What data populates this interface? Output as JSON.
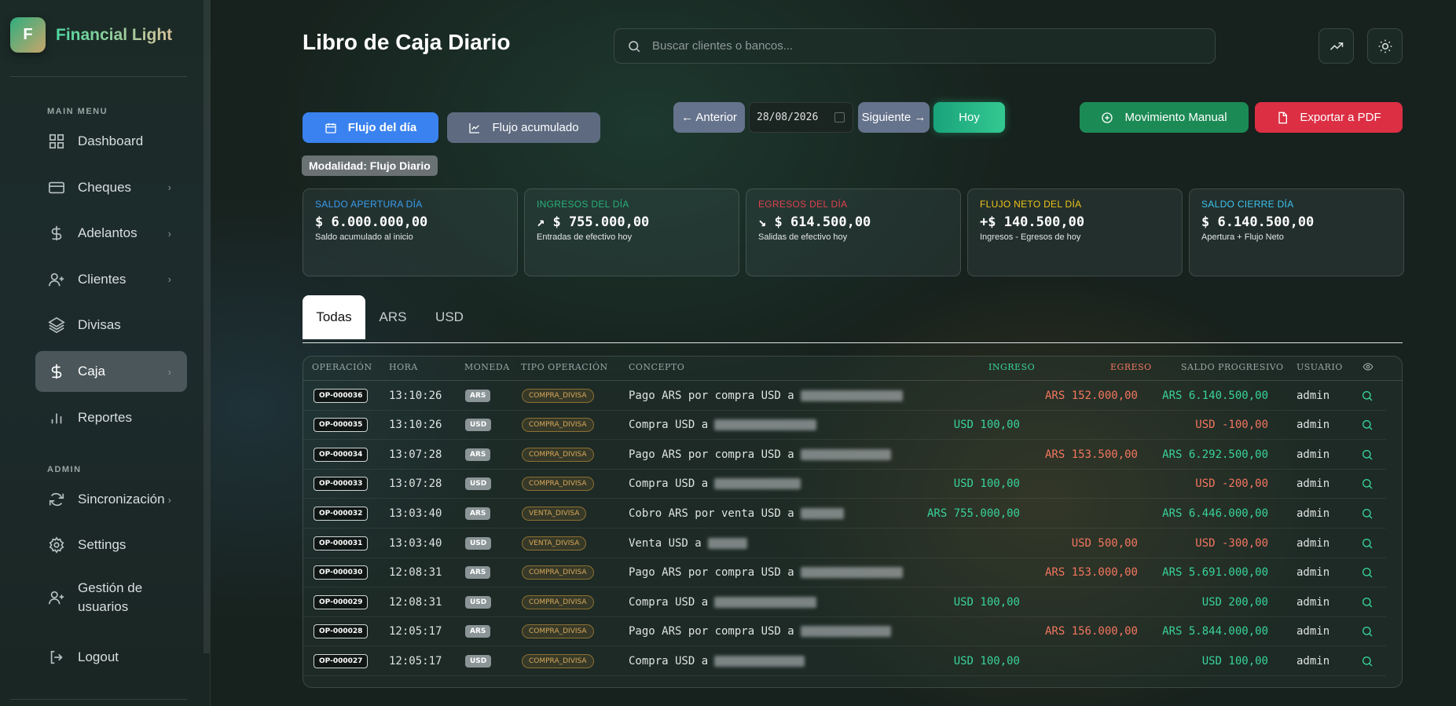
{
  "brand": {
    "initial": "F",
    "name": "Financial Light"
  },
  "sidebar": {
    "main_menu_label": "MAIN MENU",
    "admin_label": "ADMIN",
    "items": [
      {
        "label": "Dashboard",
        "icon": "grid-icon",
        "chevron": ""
      },
      {
        "label": "Cheques",
        "icon": "card-icon",
        "chevron": "›"
      },
      {
        "label": "Adelantos",
        "icon": "dollar-icon",
        "chevron": "›"
      },
      {
        "label": "Clientes",
        "icon": "user-plus-icon",
        "chevron": "›"
      },
      {
        "label": "Divisas",
        "icon": "layers-icon",
        "chevron": ""
      },
      {
        "label": "Caja",
        "icon": "dollar-icon",
        "chevron": "›",
        "active": true
      },
      {
        "label": "Reportes",
        "icon": "bar-chart-icon",
        "chevron": ""
      }
    ],
    "admin_items": [
      {
        "label": "Sincronización",
        "icon": "refresh-icon",
        "chevron": "›"
      },
      {
        "label": "Settings",
        "icon": "gear-icon",
        "chevron": ""
      },
      {
        "label": "Gestión de usuarios",
        "icon": "user-plus-icon",
        "chevron": ""
      },
      {
        "label": "Logout",
        "icon": "logout-icon",
        "chevron": ""
      }
    ]
  },
  "header": {
    "title": "Libro de Caja Diario",
    "search_placeholder": "Buscar clientes o bancos..."
  },
  "toolbar": {
    "flujo_dia": "Flujo del día",
    "flujo_acumulado": "Flujo acumulado",
    "anterior": "← Anterior",
    "date": "28/08/2026",
    "siguiente": "Siguiente →",
    "hoy": "Hoy",
    "movimiento_manual": "Movimiento Manual",
    "exportar_pdf": "Exportar a PDF",
    "modalidad": "Modalidad: Flujo Diario"
  },
  "cards": [
    {
      "title": "SALDO APERTURA DÍA",
      "value": "$ 6.000.000,00",
      "sub": "Saldo acumulado al inicio",
      "color": "#3a9cf0"
    },
    {
      "title": "INGRESOS DEL DÍA",
      "value": "↗ $ 755.000,00",
      "sub": "Entradas de efectivo hoy",
      "color": "#27b07a"
    },
    {
      "title": "EGRESOS DEL DÍA",
      "value": "↘ $ 614.500,00",
      "sub": "Salidas de efectivo hoy",
      "color": "#e0404f"
    },
    {
      "title": "FLUJO NETO DEL DÍA",
      "value": "+$ 140.500,00",
      "sub": "Ingresos - Egresos de hoy",
      "color": "#f0c419"
    },
    {
      "title": "SALDO CIERRE DÍA",
      "value": "$ 6.140.500,00",
      "sub": "Apertura + Flujo Neto",
      "color": "#3ec3f0"
    }
  ],
  "tabs": [
    "Todas",
    "ARS",
    "USD"
  ],
  "table": {
    "headers": {
      "operacion": "OPERACIÓN",
      "hora": "HORA",
      "moneda": "MONEDA",
      "tipo": "TIPO OPERACIÓN",
      "concepto": "CONCEPTO",
      "ingreso": "INGRESO",
      "egreso": "EGRESO",
      "saldo": "SALDO PROGRESIVO",
      "usuario": "USUARIO"
    },
    "rows": [
      {
        "op": "OP-000036",
        "hora": "13:10:26",
        "moneda": "ARS",
        "tipo": "COMPRA_DIVISA",
        "concepto": "Pago ARS por compra USD a",
        "blur_w": 130,
        "ingreso": "",
        "egreso": "ARS 152.000,00",
        "saldo": "ARS 6.140.500,00",
        "saldo_pos": true,
        "usuario": "admin"
      },
      {
        "op": "OP-000035",
        "hora": "13:10:26",
        "moneda": "USD",
        "tipo": "COMPRA_DIVISA",
        "concepto": "Compra USD a",
        "blur_w": 130,
        "ingreso": "USD 100,00",
        "egreso": "",
        "saldo": "USD -100,00",
        "saldo_pos": false,
        "usuario": "admin"
      },
      {
        "op": "OP-000034",
        "hora": "13:07:28",
        "moneda": "ARS",
        "tipo": "COMPRA_DIVISA",
        "concepto": "Pago ARS por compra USD a",
        "blur_w": 115,
        "ingreso": "",
        "egreso": "ARS 153.500,00",
        "saldo": "ARS 6.292.500,00",
        "saldo_pos": true,
        "usuario": "admin"
      },
      {
        "op": "OP-000033",
        "hora": "13:07:28",
        "moneda": "USD",
        "tipo": "COMPRA_DIVISA",
        "concepto": "Compra USD a",
        "blur_w": 110,
        "ingreso": "USD 100,00",
        "egreso": "",
        "saldo": "USD -200,00",
        "saldo_pos": false,
        "usuario": "admin"
      },
      {
        "op": "OP-000032",
        "hora": "13:03:40",
        "moneda": "ARS",
        "tipo": "VENTA_DIVISA",
        "concepto": "Cobro ARS por venta USD a",
        "blur_w": 55,
        "ingreso": "ARS 755.000,00",
        "egreso": "",
        "saldo": "ARS 6.446.000,00",
        "saldo_pos": true,
        "usuario": "admin"
      },
      {
        "op": "OP-000031",
        "hora": "13:03:40",
        "moneda": "USD",
        "tipo": "VENTA_DIVISA",
        "concepto": "Venta USD a",
        "blur_w": 50,
        "ingreso": "",
        "egreso": "USD 500,00",
        "saldo": "USD -300,00",
        "saldo_pos": false,
        "usuario": "admin"
      },
      {
        "op": "OP-000030",
        "hora": "12:08:31",
        "moneda": "ARS",
        "tipo": "COMPRA_DIVISA",
        "concepto": "Pago ARS por compra USD a",
        "blur_w": 130,
        "ingreso": "",
        "egreso": "ARS 153.000,00",
        "saldo": "ARS 5.691.000,00",
        "saldo_pos": true,
        "usuario": "admin"
      },
      {
        "op": "OP-000029",
        "hora": "12:08:31",
        "moneda": "USD",
        "tipo": "COMPRA_DIVISA",
        "concepto": "Compra USD a",
        "blur_w": 130,
        "ingreso": "USD 100,00",
        "egreso": "",
        "saldo": "USD 200,00",
        "saldo_pos": true,
        "usuario": "admin"
      },
      {
        "op": "OP-000028",
        "hora": "12:05:17",
        "moneda": "ARS",
        "tipo": "COMPRA_DIVISA",
        "concepto": "Pago ARS por compra USD a",
        "blur_w": 115,
        "ingreso": "",
        "egreso": "ARS 156.000,00",
        "saldo": "ARS 5.844.000,00",
        "saldo_pos": true,
        "usuario": "admin"
      },
      {
        "op": "OP-000027",
        "hora": "12:05:17",
        "moneda": "USD",
        "tipo": "COMPRA_DIVISA",
        "concepto": "Compra USD a",
        "blur_w": 115,
        "ingreso": "USD 100,00",
        "egreso": "",
        "saldo": "USD 100,00",
        "saldo_pos": true,
        "usuario": "admin"
      }
    ]
  }
}
